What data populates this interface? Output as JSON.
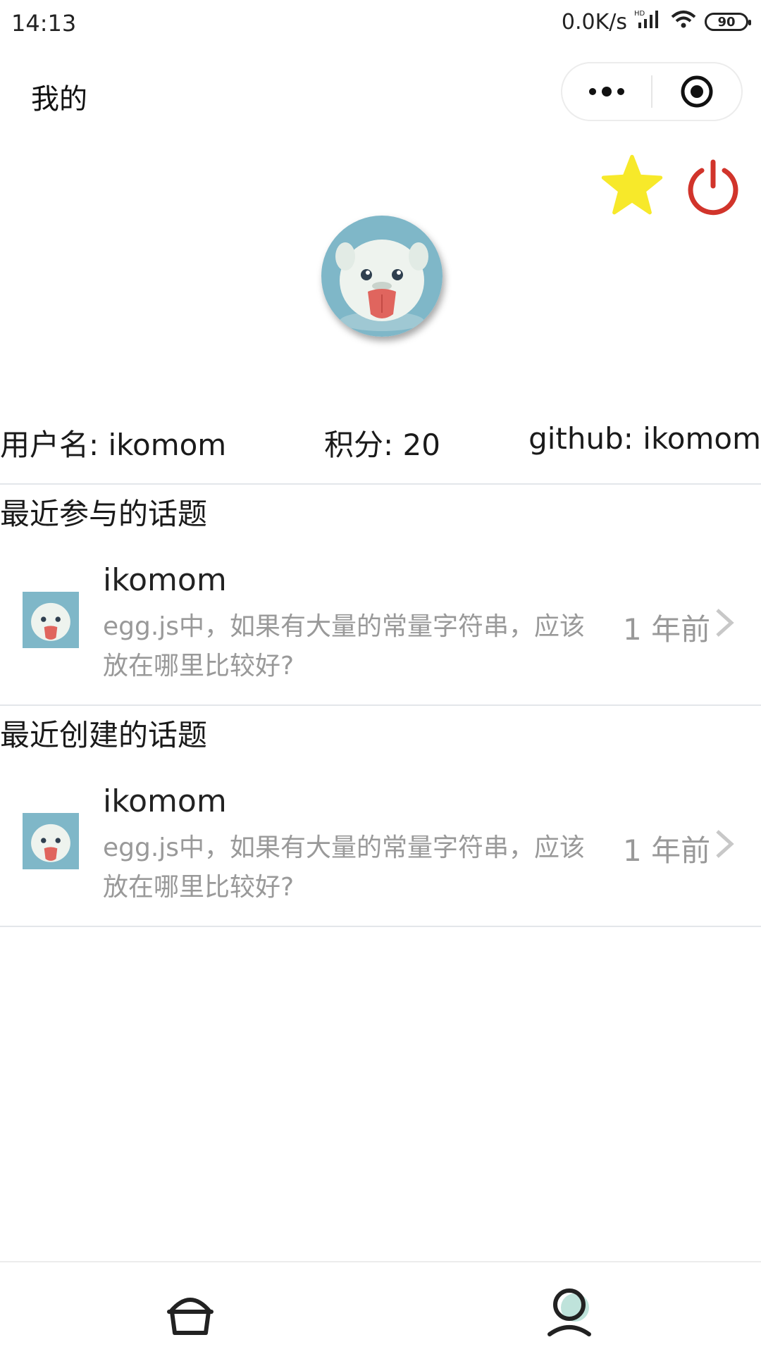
{
  "status_bar": {
    "time": "14:13",
    "net_speed": "0.0K/s",
    "battery": "90"
  },
  "nav": {
    "title": "我的"
  },
  "profile": {
    "username": "用户名: ikomom",
    "score": "积分: 20",
    "github": "github: ikomom"
  },
  "sections": [
    {
      "title": "最近参与的话题",
      "item": {
        "author": "ikomom",
        "title": "egg.js中，如果有大量的常量字符串，应该放在哪里比较好?",
        "time": "1 年前"
      }
    },
    {
      "title": "最近创建的话题",
      "item": {
        "author": "ikomom",
        "title": "egg.js中，如果有大量的常量字符串，应该放在哪里比较好?",
        "time": "1 年前"
      }
    }
  ],
  "colors": {
    "star": "#f7e92a",
    "power": "#d1342b",
    "avatar_bg": "#7fb7c8",
    "tab_active_accent": "#bfe3db"
  },
  "icons": [
    "wifi-icon",
    "signal-icon",
    "more-icon",
    "target-icon",
    "star-icon",
    "power-icon",
    "chevron-right-icon",
    "home-icon",
    "user-icon"
  ]
}
